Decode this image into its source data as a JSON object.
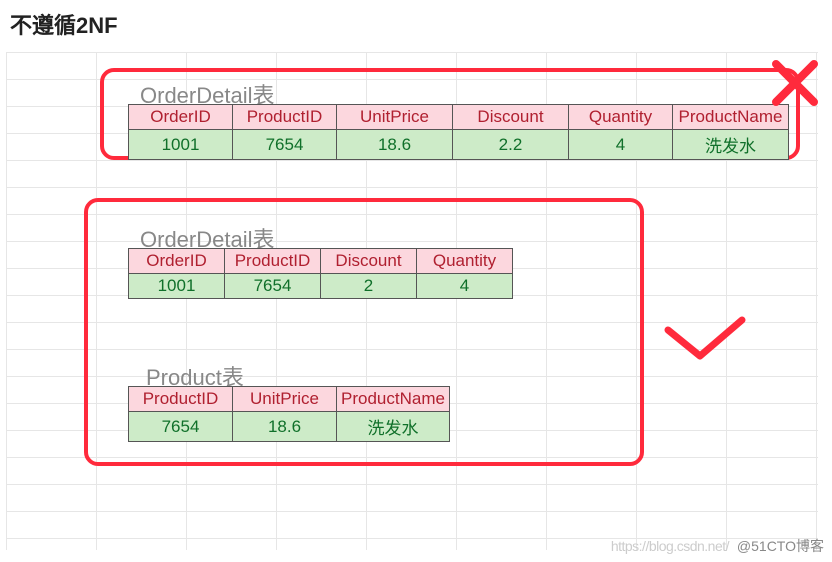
{
  "page_title": "不遵循2NF",
  "bad": {
    "title": "OrderDetail表",
    "columns": [
      "OrderID",
      "ProductID",
      "UnitPrice",
      "Discount",
      "Quantity",
      "ProductName"
    ],
    "row": [
      "1001",
      "7654",
      "18.6",
      "2.2",
      "4",
      "洗发水"
    ]
  },
  "good": {
    "orderdetail": {
      "title": "OrderDetail表",
      "columns": [
        "OrderID",
        "ProductID",
        "Discount",
        "Quantity"
      ],
      "row": [
        "1001",
        "7654",
        "2",
        "4"
      ]
    },
    "product": {
      "title": "Product表",
      "columns": [
        "ProductID",
        "UnitPrice",
        "ProductName"
      ],
      "row": [
        "7654",
        "18.6",
        "洗发水"
      ]
    }
  },
  "watermark": {
    "faint": "https://blog.csdn.net/",
    "main": "@51CTO博客"
  }
}
